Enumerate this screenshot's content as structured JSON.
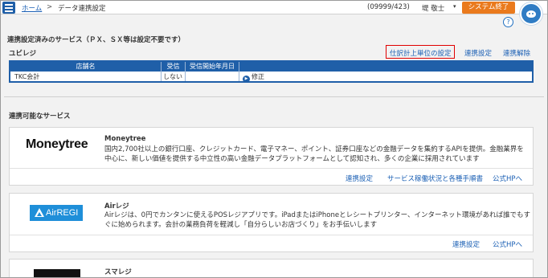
{
  "header": {
    "breadcrumb": {
      "home": "ホーム",
      "sep": ">",
      "current": "データ連携設定"
    },
    "user_id": "(09999/423)",
    "user_name": "堤 敬士",
    "user_caret": "▾",
    "system_exit": "システム終了",
    "help": "?"
  },
  "linked": {
    "title": "連携設定済みのサービス（ＰＸ、ＳＸ等は設定不要です）",
    "group": "ユビレジ",
    "actions": {
      "journal_setting": "仕訳計上単位の設定",
      "setting": "連携設定",
      "unlink": "連携解除"
    },
    "columns": [
      "店舗名",
      "受信",
      "受信開始年月日",
      ""
    ],
    "rows": [
      {
        "store": "TKC会計",
        "receive": "しない",
        "start_date": "",
        "edit": "修正"
      }
    ]
  },
  "available": {
    "title": "連携可能なサービス",
    "services": [
      {
        "logo_text": "Moneytree",
        "name": "Moneytree",
        "desc": "国内2,700社以上の銀行口座、クレジットカード、電子マネー、ポイント、証券口座などの金融データを集約するAPIを提供。金融業界を中心に、新しい価値を提供する中立性の高い金融データプラットフォームとして認知され、多くの企業に採用されています",
        "links": [
          "連携設定",
          "サービス稼働状況と各種手順書",
          "公式HPへ"
        ]
      },
      {
        "logo_text": "AirREGI",
        "name": "Airレジ",
        "desc": "Airレジは、0円でカンタンに使えるPOSレジアプリです。iPadまたはiPhoneとレシートプリンター、インターネット環境があれば誰でもすぐに始められます。会計の業務負荷を軽減し「自分らしいお店づくり」をお手伝いします",
        "links": [
          "連携設定",
          "公式HPへ"
        ]
      },
      {
        "name": "スマレジ"
      }
    ]
  },
  "colors": {
    "brand_blue": "#1f5fa8",
    "link": "#1a5fb4",
    "exit_orange": "#ea7a1d",
    "highlight_red": "#e00000",
    "airregi_blue": "#1f8fd9"
  }
}
